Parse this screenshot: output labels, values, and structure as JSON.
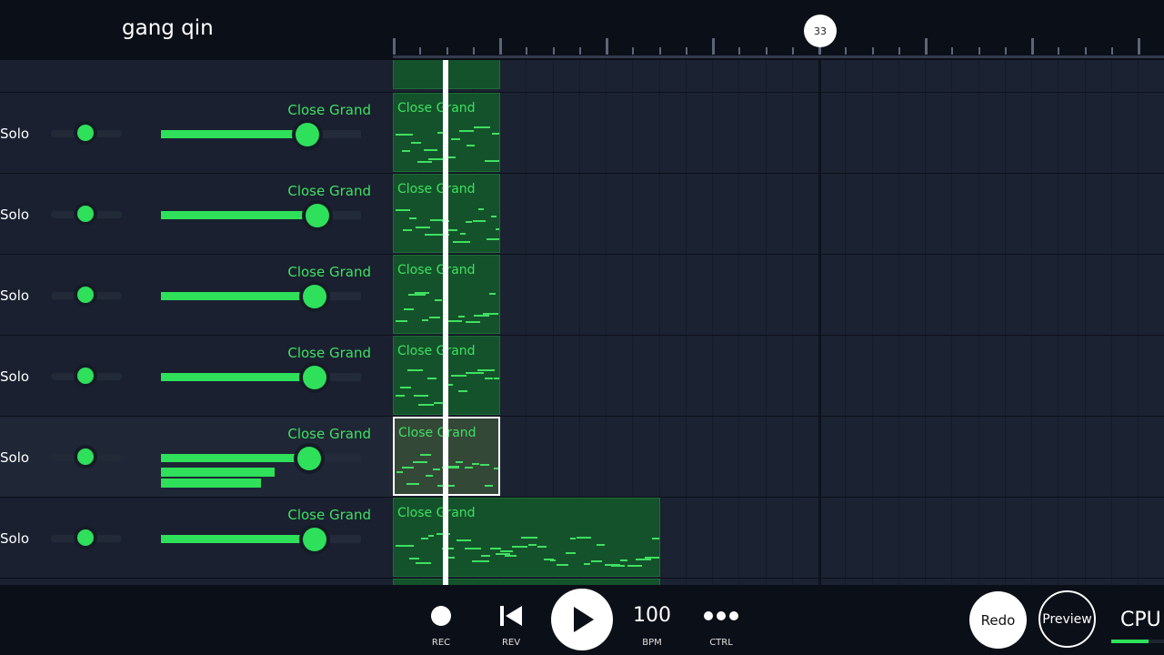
{
  "header": {
    "song_title": "gang qin",
    "bar_marker": "33"
  },
  "tracks": [
    {
      "solo_label": "Solo",
      "instrument": "Close Grand",
      "volume": 0.73,
      "selected": false,
      "extra_bars": []
    },
    {
      "solo_label": "Solo",
      "instrument": "Close Grand",
      "volume": 0.78,
      "selected": false,
      "extra_bars": []
    },
    {
      "solo_label": "Solo",
      "instrument": "Close Grand",
      "volume": 0.77,
      "selected": false,
      "extra_bars": []
    },
    {
      "solo_label": "Solo",
      "instrument": "Close Grand",
      "volume": 0.77,
      "selected": false,
      "extra_bars": []
    },
    {
      "solo_label": "Solo",
      "instrument": "Close Grand",
      "volume": 0.74,
      "selected": true,
      "extra_bars": [
        0.57,
        0.5
      ]
    },
    {
      "solo_label": "Solo",
      "instrument": "Close Grand",
      "volume": 0.77,
      "selected": false,
      "extra_bars": []
    }
  ],
  "clips": [
    {
      "label": "Close Grand",
      "length_bars": 4,
      "selected": false
    },
    {
      "label": "Close Grand",
      "length_bars": 4,
      "selected": false
    },
    {
      "label": "Close Grand",
      "length_bars": 4,
      "selected": false
    },
    {
      "label": "Close Grand",
      "length_bars": 4,
      "selected": false
    },
    {
      "label": "Close Grand",
      "length_bars": 4,
      "selected": true
    },
    {
      "label": "Close Grand",
      "length_bars": 10,
      "selected": false
    }
  ],
  "transport": {
    "rec_label": "REC",
    "rev_label": "REV",
    "bpm_value": "100",
    "bpm_label": "BPM",
    "ctrl_label": "CTRL",
    "redo_label": "Redo",
    "preview_label": "Preview",
    "cpu_label": "CPU",
    "cpu_load": 0.7
  },
  "colors": {
    "accent": "#2ee05a",
    "clip_bg": "#14522b",
    "background": "#1a2030"
  },
  "icons": {
    "rec": "record-icon",
    "rev": "skip-back-icon",
    "play": "play-icon",
    "ctrl": "more-dots-icon"
  }
}
